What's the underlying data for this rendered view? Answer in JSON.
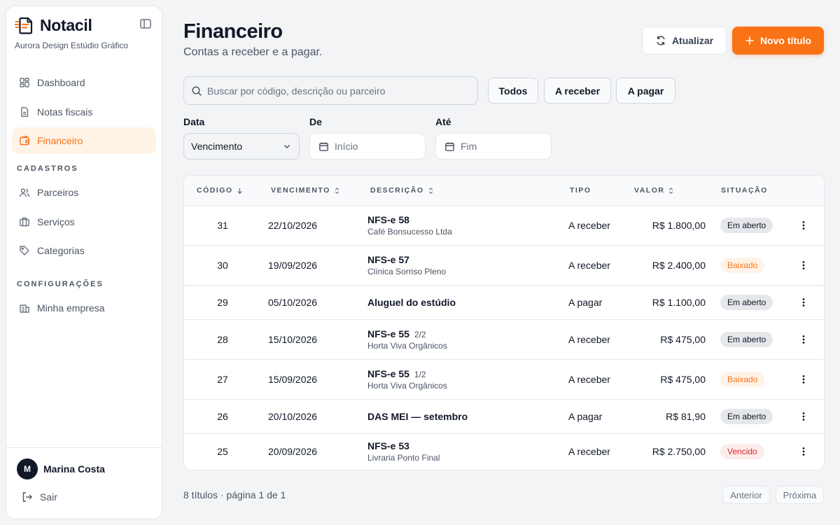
{
  "brand": {
    "name": "Notacil",
    "company": "Aurora Design Estúdio Gráfico",
    "accent": "#f97316"
  },
  "sidebar": {
    "items": [
      {
        "label": "Dashboard",
        "icon": "dashboard-icon"
      },
      {
        "label": "Notas fiscais",
        "icon": "document-icon"
      },
      {
        "label": "Financeiro",
        "icon": "wallet-icon",
        "active": true
      }
    ],
    "sections": [
      {
        "label": "CADASTROS",
        "items": [
          {
            "label": "Parceiros",
            "icon": "users-icon"
          },
          {
            "label": "Serviços",
            "icon": "briefcase-icon"
          },
          {
            "label": "Categorias",
            "icon": "tag-icon"
          }
        ]
      },
      {
        "label": "CONFIGURAÇÕES",
        "items": [
          {
            "label": "Minha empresa",
            "icon": "building-icon"
          }
        ]
      }
    ],
    "user": {
      "initial": "M",
      "name": "Marina Costa"
    },
    "logout_label": "Sair"
  },
  "header": {
    "title": "Financeiro",
    "subtitle": "Contas a receber e a pagar.",
    "refresh_label": "Atualizar",
    "new_label": "Novo título"
  },
  "filters": {
    "search_placeholder": "Buscar por código, descrição ou parceiro",
    "tabs": [
      "Todos",
      "A receber",
      "A pagar"
    ],
    "date_label": "Data",
    "date_value": "Vencimento",
    "from_label": "De",
    "from_placeholder": "Início",
    "to_label": "Até",
    "to_placeholder": "Fim"
  },
  "table": {
    "columns": [
      "CÓDIGO",
      "VENCIMENTO",
      "DESCRIÇÃO",
      "TIPO",
      "VALOR",
      "SITUAÇÃO"
    ],
    "rows": [
      {
        "code": "31",
        "due": "22/10/2026",
        "desc": "NFS-e 58",
        "installment": "",
        "partner": "Café Bonsucesso Ltda",
        "type": "A receber",
        "value": "R$ 1.800,00",
        "status": "Em aberto",
        "status_kind": "open"
      },
      {
        "code": "30",
        "due": "19/09/2026",
        "desc": "NFS-e 57",
        "installment": "",
        "partner": "Clínica Sorriso Pleno",
        "type": "A receber",
        "value": "R$ 2.400,00",
        "status": "Baixado",
        "status_kind": "done"
      },
      {
        "code": "29",
        "due": "05/10/2026",
        "desc": "Aluguel do estúdio",
        "installment": "",
        "partner": "",
        "type": "A pagar",
        "value": "R$ 1.100,00",
        "status": "Em aberto",
        "status_kind": "open"
      },
      {
        "code": "28",
        "due": "15/10/2026",
        "desc": "NFS-e 55",
        "installment": "2/2",
        "partner": "Horta Viva Orgânicos",
        "type": "A receber",
        "value": "R$ 475,00",
        "status": "Em aberto",
        "status_kind": "open"
      },
      {
        "code": "27",
        "due": "15/09/2026",
        "desc": "NFS-e 55",
        "installment": "1/2",
        "partner": "Horta Viva Orgânicos",
        "type": "A receber",
        "value": "R$ 475,00",
        "status": "Baixado",
        "status_kind": "done"
      },
      {
        "code": "26",
        "due": "20/10/2026",
        "desc": "DAS MEI — setembro",
        "installment": "",
        "partner": "",
        "type": "A pagar",
        "value": "R$ 81,90",
        "status": "Em aberto",
        "status_kind": "open"
      },
      {
        "code": "25",
        "due": "20/09/2026",
        "desc": "NFS-e 53",
        "installment": "",
        "partner": "Livraria Ponto Final",
        "type": "A receber",
        "value": "R$ 2.750,00",
        "status": "Vencido",
        "status_kind": "late"
      }
    ]
  },
  "pager": {
    "info": "8 títulos · página 1 de 1",
    "prev": "Anterior",
    "next": "Próxima"
  }
}
